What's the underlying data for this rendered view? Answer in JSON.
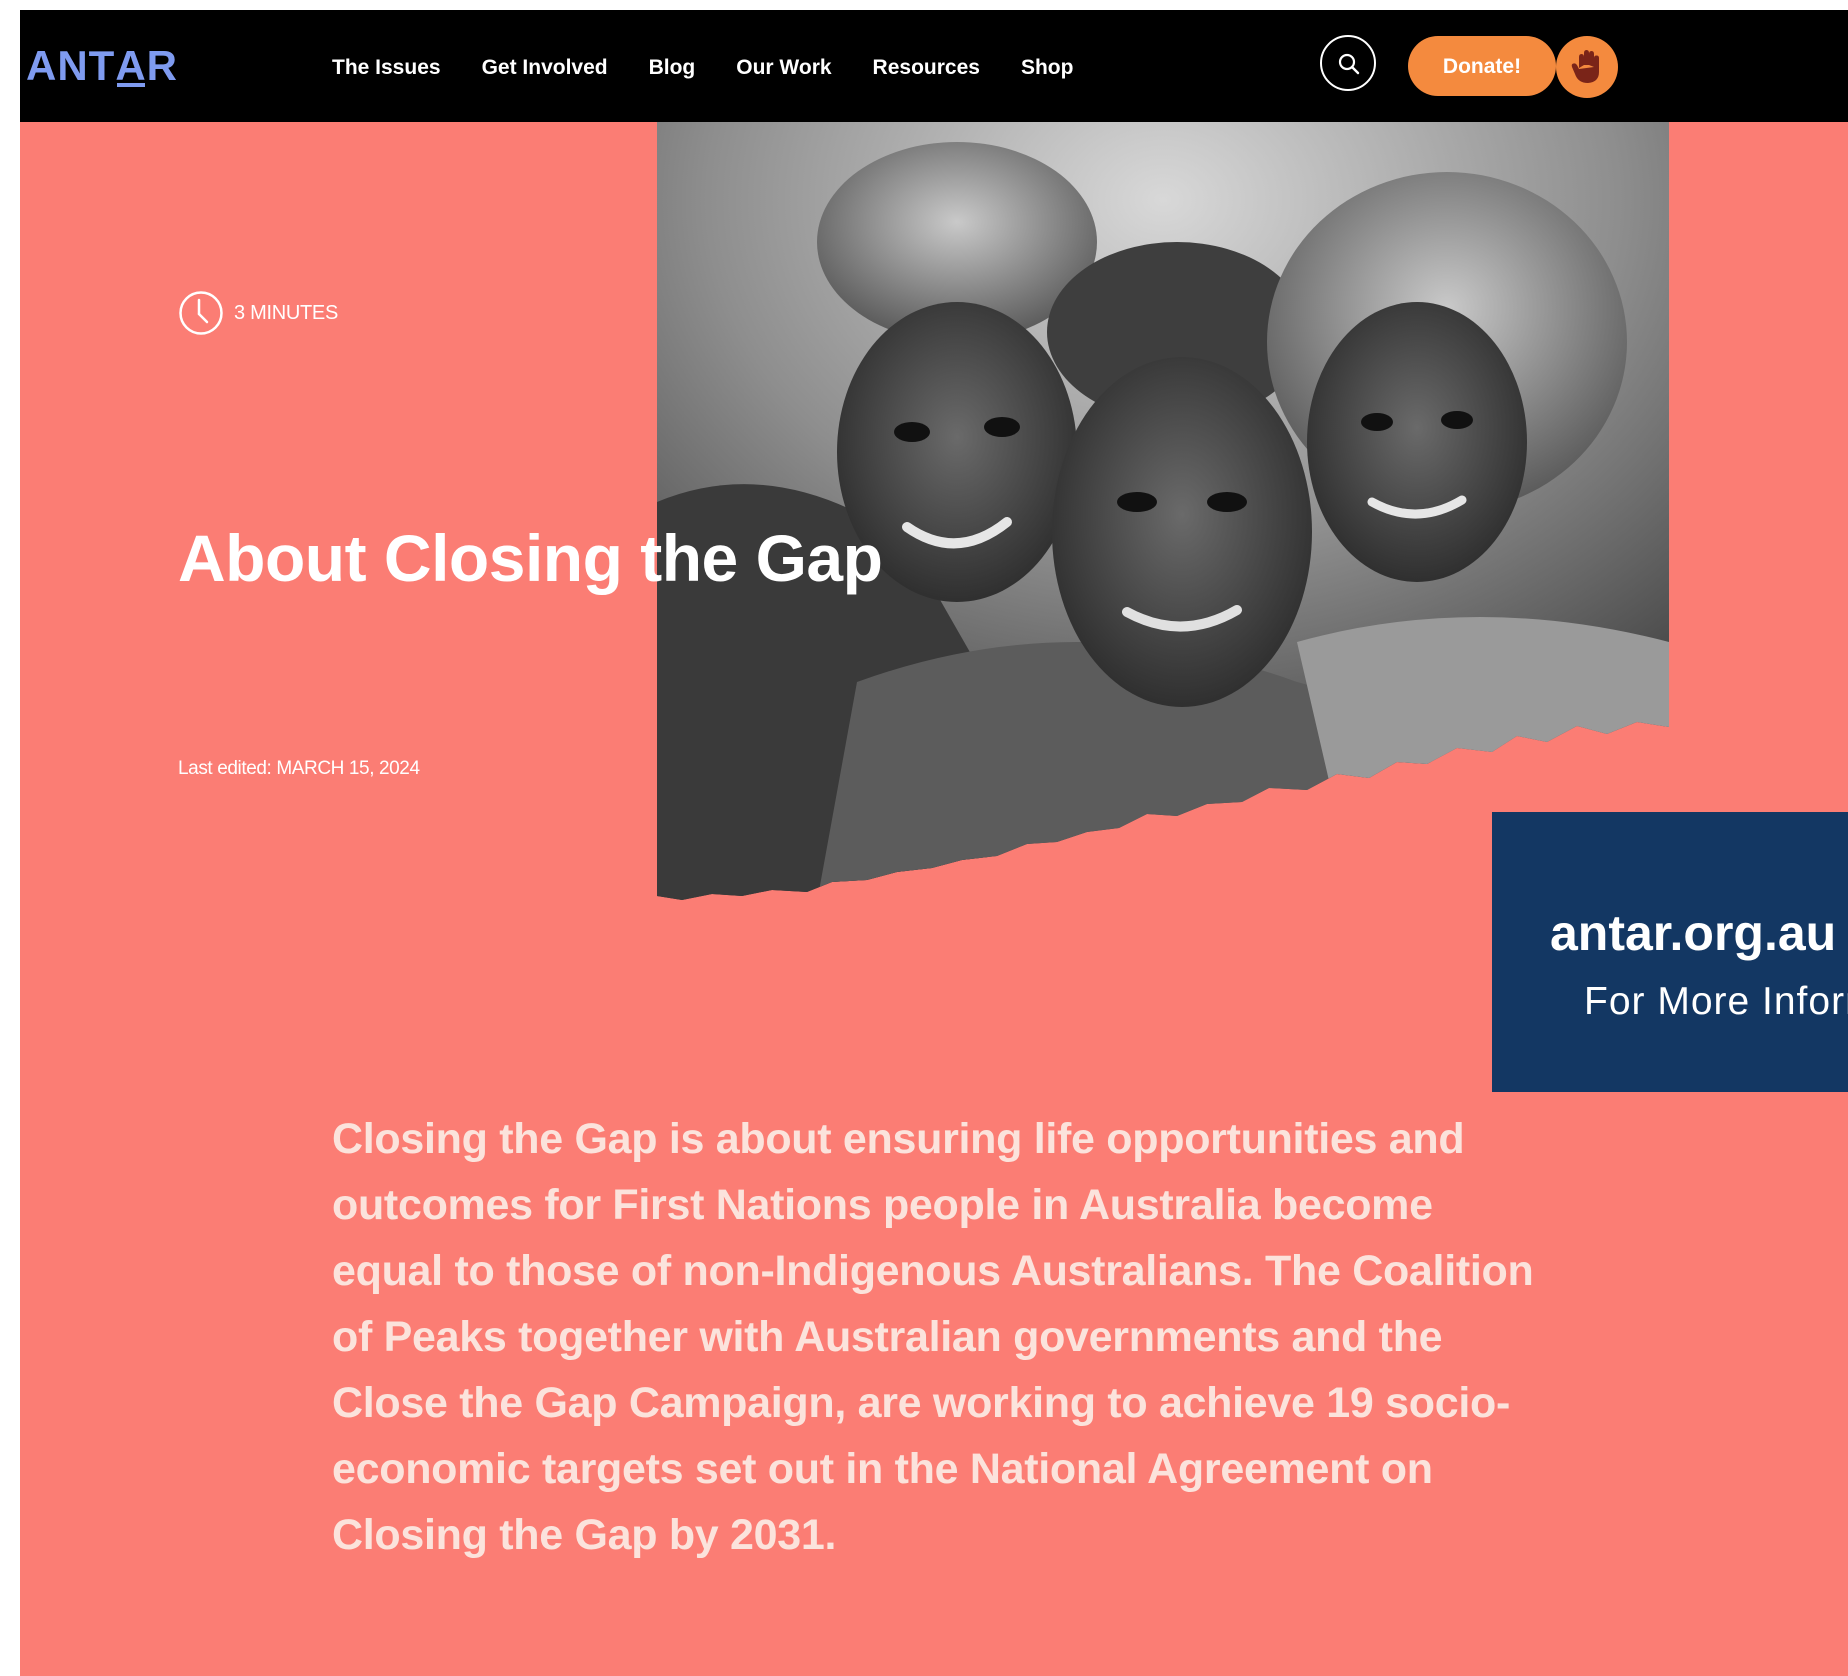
{
  "header": {
    "logo_text": "ANTAR",
    "nav_items": [
      {
        "label": "The Issues"
      },
      {
        "label": "Get Involved"
      },
      {
        "label": "Blog"
      },
      {
        "label": "Our Work"
      },
      {
        "label": "Resources"
      },
      {
        "label": "Shop"
      }
    ],
    "search_icon": "search-icon",
    "donate_label": "Donate!",
    "badge_icon": "hand-icon"
  },
  "hero": {
    "read_time": "3 MINUTES",
    "read_time_icon": "clock-icon",
    "title": "About Closing the Gap",
    "last_edited": "Last edited: MARCH 15, 2024"
  },
  "promo": {
    "url": "antar.org.au",
    "subtitle": "For More Information"
  },
  "body": {
    "intro": "Closing the Gap is about ensuring life opportunities and outcomes for First Nations people in Australia become equal to those of non-Indigenous Australians. The Coalition of Peaks together with Australian governments and the Close the Gap Campaign, are working to achieve 19 socio-economic targets set out in the National Agreement on Closing the Gap by 2031."
  },
  "colors": {
    "page_background": "#fb7d74",
    "header_background": "#000000",
    "logo": "#7f9bf0",
    "donate_button": "#f48a3e",
    "promo_background": "#133763",
    "intro_text": "#fbe3dc"
  }
}
